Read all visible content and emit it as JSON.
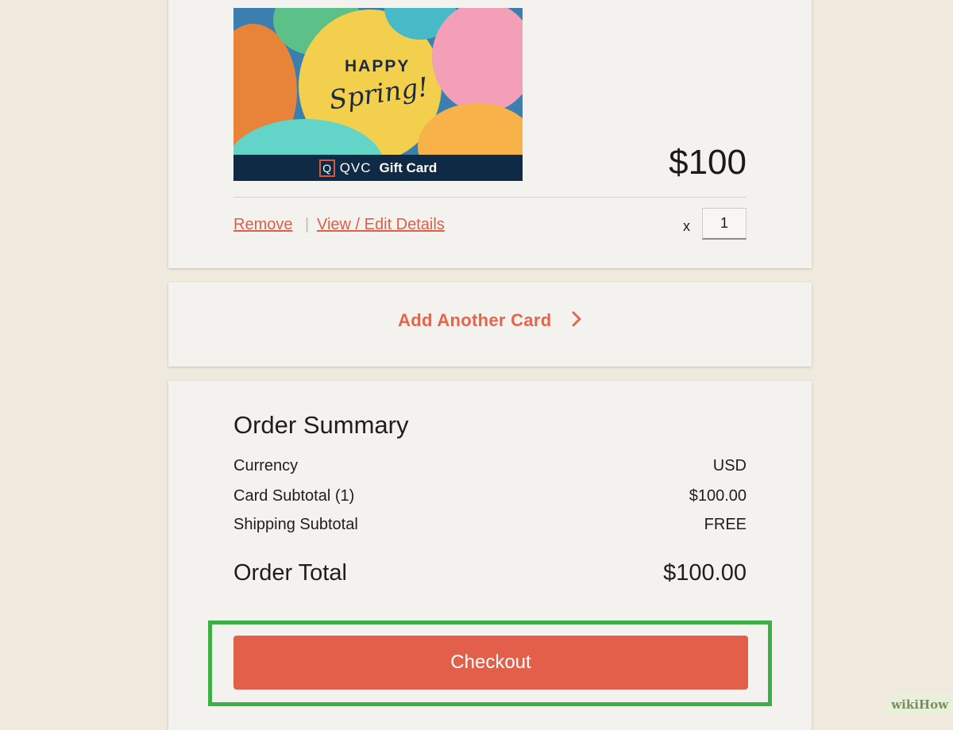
{
  "card_item": {
    "image": {
      "greeting_top": "HAPPY",
      "greeting_script": "Spring!",
      "brand_box_letter": "Q",
      "brand_name": "QVC",
      "card_word": "Gift Card"
    },
    "price": "$100",
    "remove_label": "Remove",
    "separator": "|",
    "edit_label": "View / Edit Details",
    "quantity_prefix": "x",
    "quantity": "1"
  },
  "add_card": {
    "label": "Add Another Card",
    "icon": "chevron-right-icon"
  },
  "order_summary": {
    "title": "Order Summary",
    "rows": [
      {
        "label": "Currency",
        "value": "USD"
      },
      {
        "label": "Card Subtotal (1)",
        "value": "$100.00"
      },
      {
        "label": "Shipping Subtotal",
        "value": "FREE"
      }
    ],
    "total_label": "Order Total",
    "total_value": "$100.00"
  },
  "checkout": {
    "label": "Checkout",
    "highlight_color": "#3db045"
  },
  "colors": {
    "accent": "#e2604a",
    "link": "#d9614a",
    "page_background": "#efe9de",
    "panel_background": "#f3f2ef"
  },
  "watermark": "wikiHow"
}
